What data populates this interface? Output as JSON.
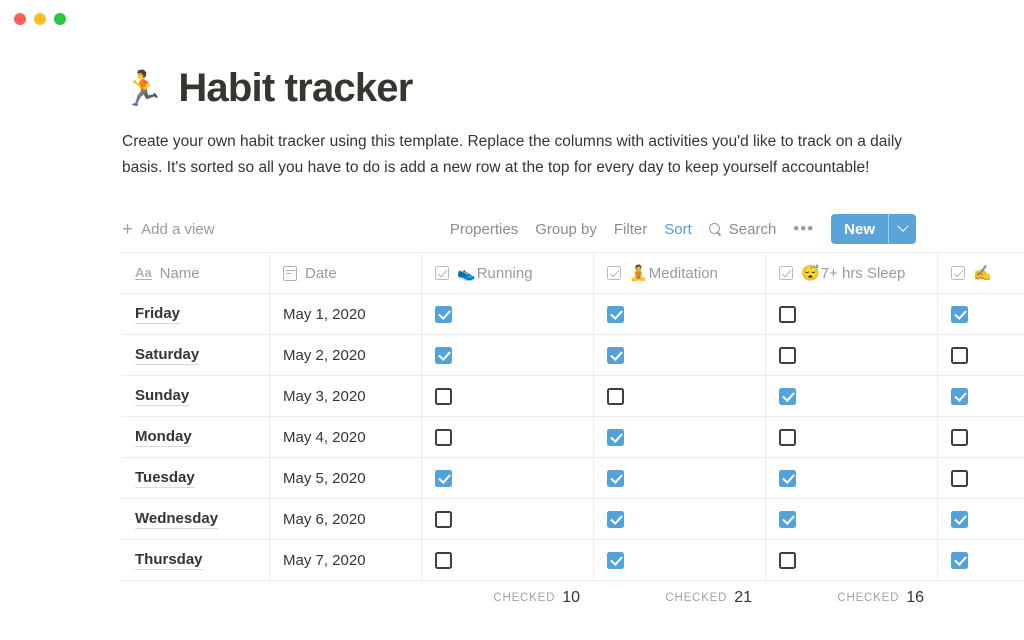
{
  "window": {
    "traffic_lights": [
      {
        "name": "close",
        "color": "#ff5f57"
      },
      {
        "name": "minimize",
        "color": "#febc2e"
      },
      {
        "name": "zoom",
        "color": "#28c840"
      }
    ]
  },
  "page": {
    "emoji": "🏃",
    "title": "Habit tracker",
    "description": "Create your own habit tracker using this template. Replace the columns with activities you'd like to track on a daily basis. It's sorted so all you have to do is add a new row at the top for every day to keep yourself accountable!"
  },
  "toolbar": {
    "add_view": "Add a view",
    "plus_icon": "+",
    "properties": "Properties",
    "group_by": "Group by",
    "filter": "Filter",
    "sort": "Sort",
    "search": "Search",
    "search_icon": "search-icon",
    "more_icon": "•••",
    "new_label": "New",
    "caret_icon": "chevron-down-icon",
    "accent_color": "#5ba4d8",
    "active_color": "#529dd4"
  },
  "table": {
    "columns": [
      {
        "key": "name",
        "label": "Name",
        "icon": "aa-text-icon",
        "emoji": ""
      },
      {
        "key": "date",
        "label": "Date",
        "icon": "calendar-icon",
        "emoji": ""
      },
      {
        "key": "running",
        "label": "Running",
        "icon": "checkbox-icon",
        "emoji": "👟"
      },
      {
        "key": "meditation",
        "label": "Meditation",
        "icon": "checkbox-icon",
        "emoji": "🧘"
      },
      {
        "key": "sleep",
        "label": "7+ hrs Sleep",
        "icon": "checkbox-icon",
        "emoji": "😴"
      },
      {
        "key": "journal",
        "label": "",
        "icon": "checkbox-icon",
        "emoji": "✍️"
      }
    ],
    "rows": [
      {
        "name": "Friday",
        "date": "May 1, 2020",
        "running": true,
        "meditation": true,
        "sleep": false,
        "journal": true
      },
      {
        "name": "Saturday",
        "date": "May 2, 2020",
        "running": true,
        "meditation": true,
        "sleep": false,
        "journal": false
      },
      {
        "name": "Sunday",
        "date": "May 3, 2020",
        "running": false,
        "meditation": false,
        "sleep": true,
        "journal": true
      },
      {
        "name": "Monday",
        "date": "May 4, 2020",
        "running": false,
        "meditation": true,
        "sleep": false,
        "journal": false
      },
      {
        "name": "Tuesday",
        "date": "May 5, 2020",
        "running": true,
        "meditation": true,
        "sleep": true,
        "journal": false
      },
      {
        "name": "Wednesday",
        "date": "May 6, 2020",
        "running": false,
        "meditation": true,
        "sleep": true,
        "journal": true
      },
      {
        "name": "Thursday",
        "date": "May 7, 2020",
        "running": false,
        "meditation": true,
        "sleep": false,
        "journal": true
      }
    ],
    "footer": {
      "label": "Checked",
      "counts": {
        "running": "10",
        "meditation": "21",
        "sleep": "16",
        "journal": ""
      }
    },
    "checkbox_on_color": "#53a3da",
    "checkbox_off_color": "#3f3f3e"
  }
}
